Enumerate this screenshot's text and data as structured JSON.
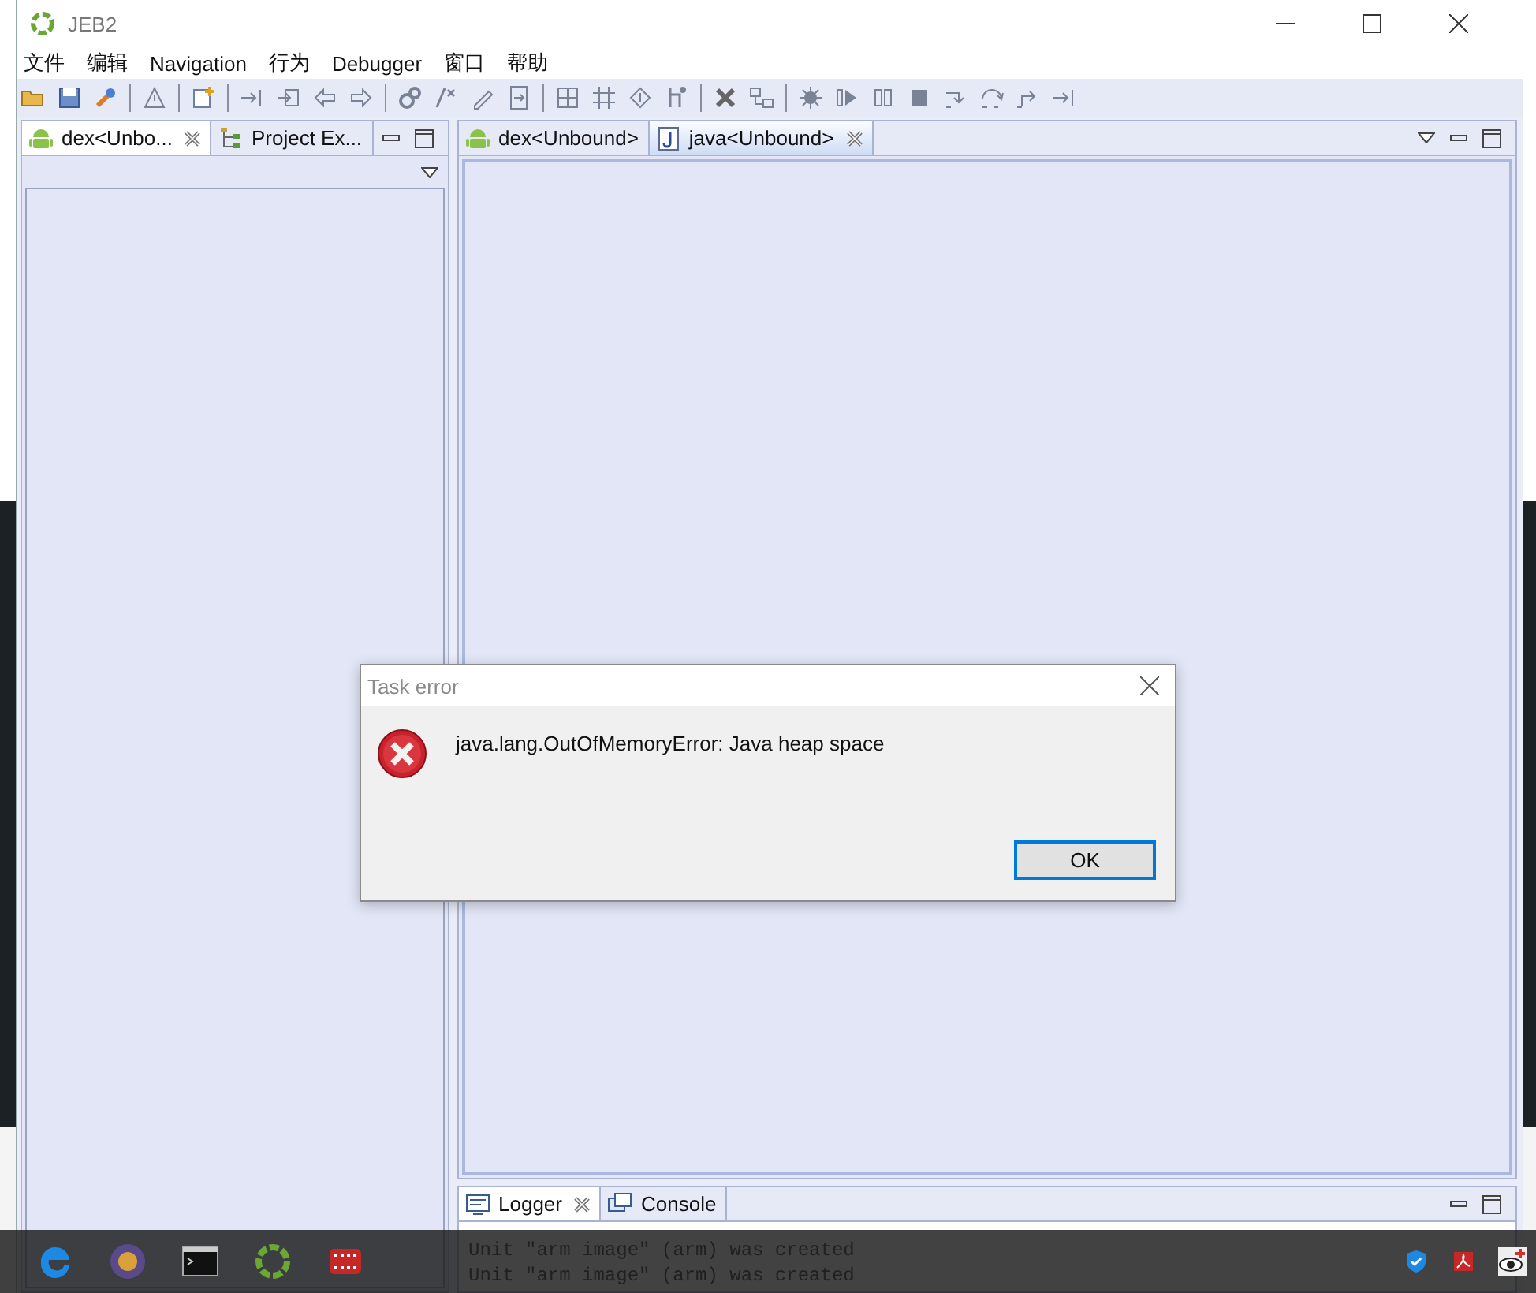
{
  "window": {
    "title": "JEB2"
  },
  "menu": [
    "文件",
    "编辑",
    "Navigation",
    "行为",
    "Debugger",
    "窗口",
    "帮助"
  ],
  "left_panel": {
    "tabs": [
      {
        "label": "dex<Unbo...",
        "kind": "android",
        "selected": true,
        "closable": true
      },
      {
        "label": "Project Ex...",
        "kind": "tree",
        "selected": false,
        "closable": false
      }
    ]
  },
  "editor": {
    "tabs": [
      {
        "label": "dex<Unbound>",
        "kind": "android",
        "selected": false,
        "closable": false
      },
      {
        "label": "java<Unbound>",
        "kind": "java",
        "selected": true,
        "closable": true
      }
    ]
  },
  "bottom_panel": {
    "tabs": [
      {
        "label": "Logger",
        "kind": "logger",
        "selected": true,
        "closable": true
      },
      {
        "label": "Console",
        "kind": "console",
        "selected": false,
        "closable": false
      }
    ],
    "log_lines": [
      "Unit \"arm image\" (arm) was created",
      "Unit \"arm image\" (arm) was created"
    ]
  },
  "dialog": {
    "title": "Task error",
    "message": "java.lang.OutOfMemoryError: Java heap space",
    "button": "OK"
  }
}
